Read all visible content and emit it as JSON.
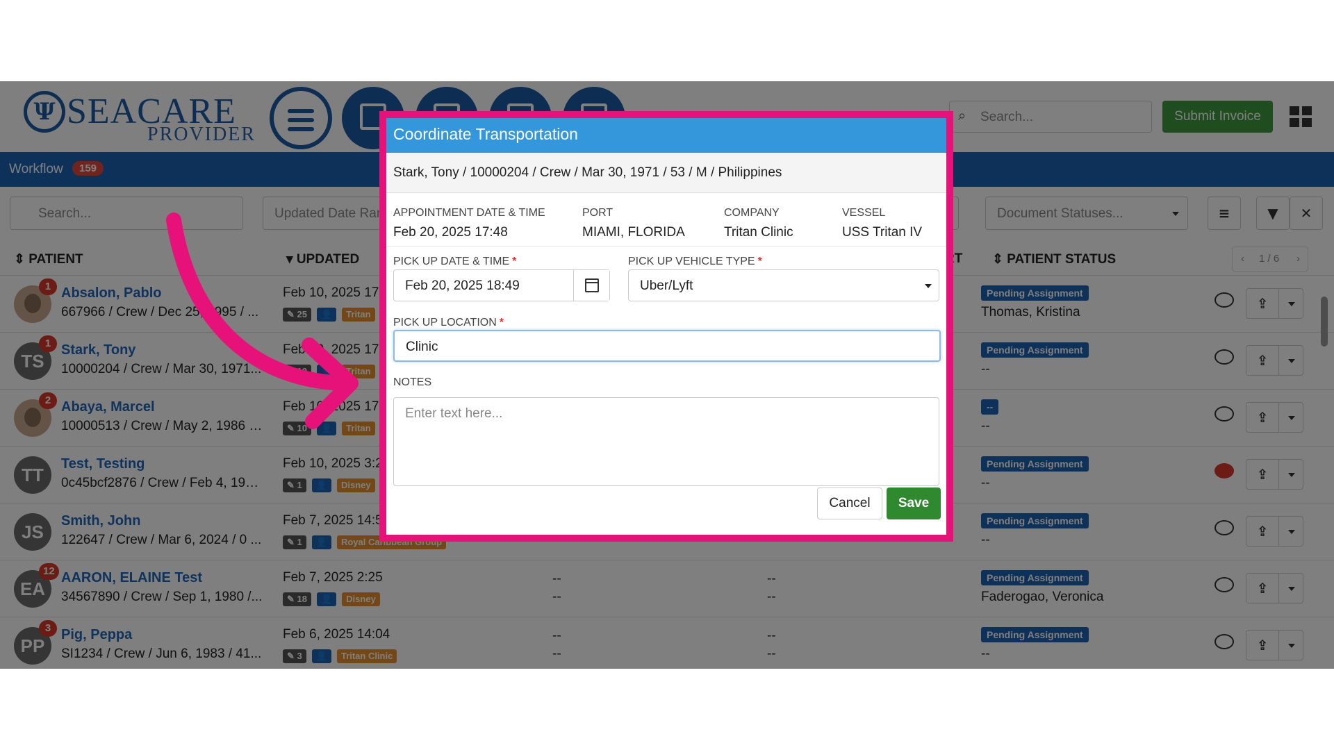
{
  "app": {
    "logo_text": "SEACARE",
    "logo_sub": "PROVIDER",
    "search_placeholder": "Search...",
    "submit_invoice": "Submit Invoice"
  },
  "workflow": {
    "label": "Workflow",
    "count": "159"
  },
  "filters": {
    "search_placeholder": "Search...",
    "updated_date_range": "Updated Date Range",
    "document_statuses": "Document Statuses..."
  },
  "table": {
    "headers": {
      "patient": "PATIENT",
      "updated": "UPDATED",
      "rt": "RT",
      "patient_status": "PATIENT STATUS"
    },
    "pagination": "1 / 6",
    "rows": [
      {
        "initials": "",
        "badge": "1",
        "name": "Absalon, Pablo",
        "info": "667966 / Crew / Dec 25, 1995 / ...",
        "updated": "Feb 10, 2025 17:",
        "c1": "25",
        "org": "Tritan",
        "d1": "",
        "d2": "",
        "status": "Pending Assignment",
        "assignee": "Thomas, Kristina",
        "chat_red": false
      },
      {
        "initials": "TS",
        "badge": "1",
        "name": "Stark, Tony",
        "info": "10000204 / Crew / Mar 30, 1971...",
        "updated": "Feb 10, 2025 17",
        "c1": "10",
        "org": "Tritan",
        "d1": "",
        "d2": "",
        "status": "Pending Assignment",
        "assignee": "--",
        "chat_red": false
      },
      {
        "initials": "",
        "badge": "2",
        "name": "Abaya, Marcel",
        "info": "10000513 / Crew / May 2, 1986 /...",
        "updated": "Feb 10, 2025 17",
        "c1": "10",
        "org": "Tritan",
        "d1": "",
        "d2": "",
        "status": "--",
        "assignee": "--",
        "chat_red": false
      },
      {
        "initials": "TT",
        "badge": "",
        "name": "Test, Testing",
        "info": "0c45bcf2876 / Crew / Feb 4, 199...",
        "updated": "Feb 10, 2025 3:2",
        "c1": "1",
        "org": "Disney",
        "d1": "",
        "d2": "",
        "status": "Pending Assignment",
        "assignee": "--",
        "chat_red": true
      },
      {
        "initials": "JS",
        "badge": "",
        "name": "Smith, John",
        "info": "122647 / Crew / Mar 6, 2024 / 0 ...",
        "updated": "Feb 7, 2025 14:5",
        "c1": "1",
        "org": "Royal Caribbean Group",
        "d1": "",
        "d2": "",
        "status": "Pending Assignment",
        "assignee": "--",
        "chat_red": false
      },
      {
        "initials": "EA",
        "badge": "12",
        "name": "AARON, ELAINE Test",
        "info": "34567890 / Crew / Sep 1, 1980 /...",
        "updated": "Feb 7, 2025 2:25",
        "c1": "18",
        "org": "Disney",
        "d1": "--",
        "d2": "--",
        "status": "Pending Assignment",
        "assignee": "Faderogao, Veronica",
        "chat_red": false
      },
      {
        "initials": "PP",
        "badge": "3",
        "name": "Pig, Peppa",
        "info": "SI1234 / Crew / Jun 6, 1983 / 41...",
        "updated": "Feb 6, 2025 14:04",
        "c1": "3",
        "org": "Tritan Clinic",
        "d1": "--",
        "d2": "--",
        "status": "Pending Assignment",
        "assignee": "--",
        "chat_red": false
      }
    ]
  },
  "modal": {
    "title": "Coordinate Transportation",
    "patient_line": "Stark, Tony / 10000204 / Crew / Mar 30, 1971 / 53 / M / Philippines",
    "meta": [
      {
        "key": "APPOINTMENT DATE & TIME",
        "value": "Feb 20, 2025 17:48"
      },
      {
        "key": "PORT",
        "value": "MIAMI, FLORIDA"
      },
      {
        "key": "COMPANY",
        "value": "Tritan Clinic"
      },
      {
        "key": "VESSEL",
        "value": "USS Tritan IV"
      }
    ],
    "pickup_datetime_label": "PICK UP DATE & TIME",
    "pickup_datetime_value": "Feb 20, 2025 18:49",
    "vehicle_type_label": "PICK UP VEHICLE TYPE",
    "vehicle_type_value": "Uber/Lyft",
    "location_label": "PICK UP LOCATION",
    "location_value": "Clinic",
    "notes_label": "NOTES",
    "notes_placeholder": "Enter text here...",
    "required_mark": "*",
    "cancel": "Cancel",
    "save": "Save"
  },
  "colors": {
    "highlight_border": "#e6127a",
    "modal_header": "#3497db",
    "save": "#2f8a2f",
    "brand": "#1a5ba6"
  }
}
